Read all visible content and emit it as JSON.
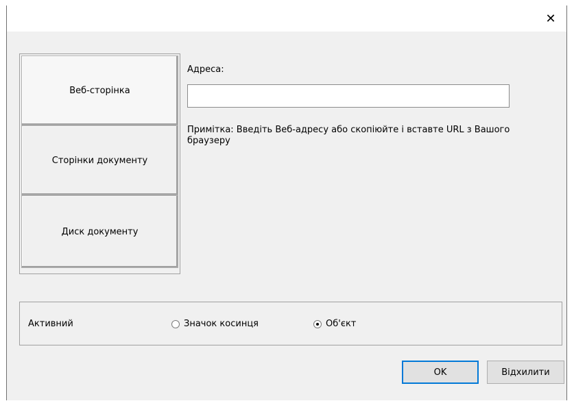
{
  "window": {
    "close_glyph": "✕"
  },
  "tabs": [
    {
      "label": "Веб-сторінка",
      "active": true
    },
    {
      "label": "Сторінки документу",
      "active": false
    },
    {
      "label": "Диск документу",
      "active": false
    }
  ],
  "web_page": {
    "address_label": "Адреса:",
    "address_value": "",
    "note": "Примітка: Введіть Веб-адресу або скопіюйте і вставте URL з Вашого браузеру"
  },
  "active": {
    "label": "Активний",
    "options": [
      {
        "label": "Значок косинця",
        "checked": false
      },
      {
        "label": "Об'єкт",
        "checked": true
      }
    ]
  },
  "buttons": {
    "ok": "OK",
    "cancel": "Відхилити"
  }
}
